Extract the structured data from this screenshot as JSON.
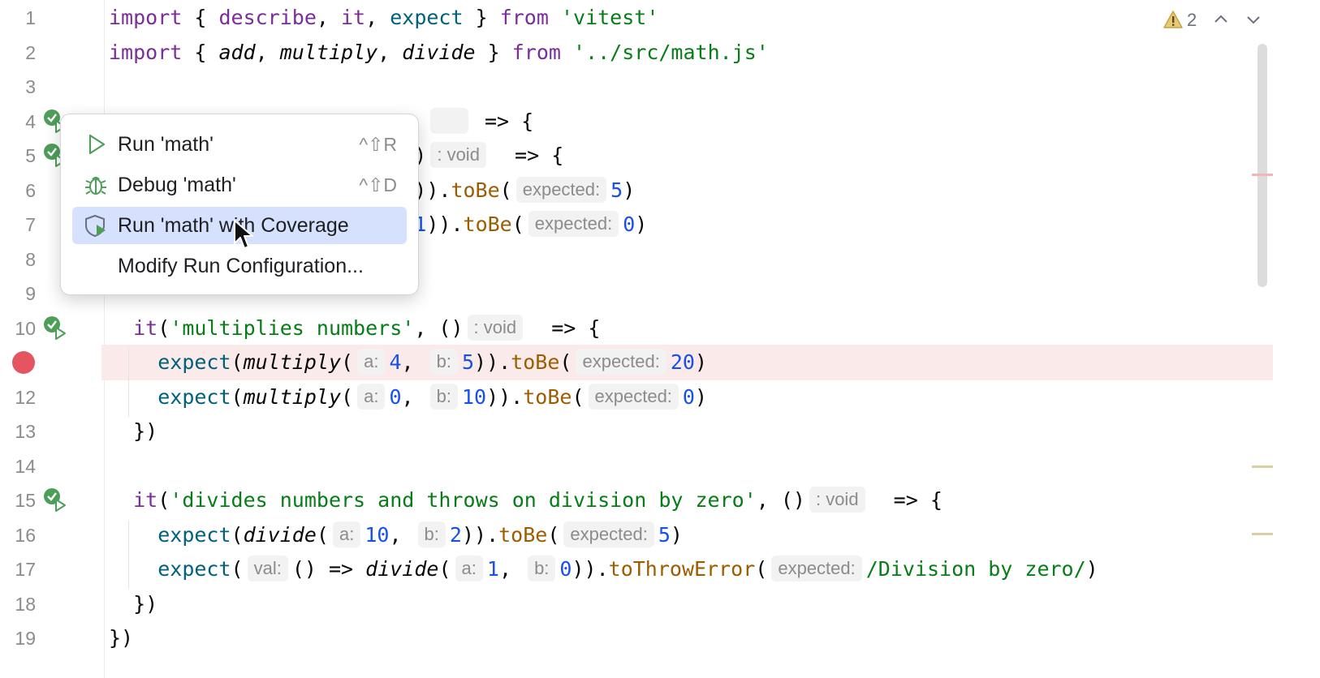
{
  "editor": {
    "lines": [
      {
        "n": "1",
        "segments": [
          {
            "t": "import",
            "c": "kw"
          },
          {
            "t": " { "
          },
          {
            "t": "describe",
            "c": "kw"
          },
          {
            "t": ", "
          },
          {
            "t": "it",
            "c": "kw"
          },
          {
            "t": ", "
          },
          {
            "t": "expect",
            "c": "fn"
          },
          {
            "t": " } "
          },
          {
            "t": "from",
            "c": "kw"
          },
          {
            "t": " "
          },
          {
            "t": "'vitest'",
            "c": "str"
          }
        ]
      },
      {
        "n": "2",
        "segments": [
          {
            "t": "import",
            "c": "kw"
          },
          {
            "t": " { "
          },
          {
            "t": "add",
            "c": "ital"
          },
          {
            "t": ", "
          },
          {
            "t": "multiply",
            "c": "ital"
          },
          {
            "t": ", "
          },
          {
            "t": "divide",
            "c": "ital"
          },
          {
            "t": " } "
          },
          {
            "t": "from",
            "c": "kw"
          },
          {
            "t": " "
          },
          {
            "t": "'../src/math.js'",
            "c": "str"
          }
        ]
      },
      {
        "n": "3",
        "segments": []
      },
      {
        "n": "4",
        "segments": [
          {
            "t": "                          "
          },
          {
            "t": "     ",
            "hint": true
          },
          {
            "t": " => {"
          }
        ]
      },
      {
        "n": "5",
        "segments": [
          {
            "t": "                         )"
          },
          {
            "t": ": void",
            "hint": true
          },
          {
            "t": "  => {"
          }
        ]
      },
      {
        "n": "6",
        "segments": [
          {
            "t": "                         ))."
          },
          {
            "t": "toBe",
            "c": "meth"
          },
          {
            "t": "("
          },
          {
            "t": "expected:",
            "hint": true
          },
          {
            "t": "5",
            "c": "num"
          },
          {
            "t": ")"
          }
        ]
      },
      {
        "n": "7",
        "segments": [
          {
            "t": "                         "
          },
          {
            "t": "1",
            "c": "num"
          },
          {
            "t": "))."
          },
          {
            "t": "toBe",
            "c": "meth"
          },
          {
            "t": "("
          },
          {
            "t": "expected:",
            "hint": true
          },
          {
            "t": "0",
            "c": "num"
          },
          {
            "t": ")"
          }
        ]
      },
      {
        "n": "8",
        "segments": []
      },
      {
        "n": "9",
        "segments": []
      },
      {
        "n": "10",
        "segments": [
          {
            "t": "  "
          },
          {
            "t": "it",
            "c": "kw"
          },
          {
            "t": "("
          },
          {
            "t": "'multiplies numbers'",
            "c": "str"
          },
          {
            "t": ", ()"
          },
          {
            "t": ": void",
            "hint": true
          },
          {
            "t": "  => {"
          }
        ]
      },
      {
        "n": "",
        "segments": [
          {
            "t": "    "
          },
          {
            "t": "expect",
            "c": "fn"
          },
          {
            "t": "("
          },
          {
            "t": "multiply",
            "c": "ital"
          },
          {
            "t": "("
          },
          {
            "t": "a:",
            "hint": true
          },
          {
            "t": "4",
            "c": "num"
          },
          {
            "t": ", "
          },
          {
            "t": "b:",
            "hint": true
          },
          {
            "t": "5",
            "c": "num"
          },
          {
            "t": "))."
          },
          {
            "t": "toBe",
            "c": "meth"
          },
          {
            "t": "("
          },
          {
            "t": "expected:",
            "hint": true
          },
          {
            "t": "20",
            "c": "num"
          },
          {
            "t": ")"
          }
        ]
      },
      {
        "n": "12",
        "segments": [
          {
            "t": "    "
          },
          {
            "t": "expect",
            "c": "fn"
          },
          {
            "t": "("
          },
          {
            "t": "multiply",
            "c": "ital"
          },
          {
            "t": "("
          },
          {
            "t": "a:",
            "hint": true
          },
          {
            "t": "0",
            "c": "num"
          },
          {
            "t": ", "
          },
          {
            "t": "b:",
            "hint": true
          },
          {
            "t": "10",
            "c": "num"
          },
          {
            "t": "))."
          },
          {
            "t": "toBe",
            "c": "meth"
          },
          {
            "t": "("
          },
          {
            "t": "expected:",
            "hint": true
          },
          {
            "t": "0",
            "c": "num"
          },
          {
            "t": ")"
          }
        ]
      },
      {
        "n": "13",
        "segments": [
          {
            "t": "  })"
          }
        ]
      },
      {
        "n": "14",
        "segments": []
      },
      {
        "n": "15",
        "segments": [
          {
            "t": "  "
          },
          {
            "t": "it",
            "c": "kw"
          },
          {
            "t": "("
          },
          {
            "t": "'divides numbers and throws on division by zero'",
            "c": "str"
          },
          {
            "t": ", ()"
          },
          {
            "t": ": void",
            "hint": true
          },
          {
            "t": "  => {"
          }
        ]
      },
      {
        "n": "16",
        "segments": [
          {
            "t": "    "
          },
          {
            "t": "expect",
            "c": "fn"
          },
          {
            "t": "("
          },
          {
            "t": "divide",
            "c": "ital"
          },
          {
            "t": "("
          },
          {
            "t": "a:",
            "hint": true
          },
          {
            "t": "10",
            "c": "num"
          },
          {
            "t": ", "
          },
          {
            "t": "b:",
            "hint": true
          },
          {
            "t": "2",
            "c": "num"
          },
          {
            "t": "))."
          },
          {
            "t": "toBe",
            "c": "meth"
          },
          {
            "t": "("
          },
          {
            "t": "expected:",
            "hint": true
          },
          {
            "t": "5",
            "c": "num"
          },
          {
            "t": ")"
          }
        ]
      },
      {
        "n": "17",
        "segments": [
          {
            "t": "    "
          },
          {
            "t": "expect",
            "c": "fn"
          },
          {
            "t": "("
          },
          {
            "t": "val:",
            "hint": true
          },
          {
            "t": "() => "
          },
          {
            "t": "divide",
            "c": "ital"
          },
          {
            "t": "("
          },
          {
            "t": "a:",
            "hint": true
          },
          {
            "t": "1",
            "c": "num"
          },
          {
            "t": ", "
          },
          {
            "t": "b:",
            "hint": true
          },
          {
            "t": "0",
            "c": "num"
          },
          {
            "t": "))."
          },
          {
            "t": "toThrowError",
            "c": "meth"
          },
          {
            "t": "("
          },
          {
            "t": "expected:",
            "hint": true
          },
          {
            "t": "/Division by zero/",
            "c": "str"
          },
          {
            "t": ")"
          }
        ]
      },
      {
        "n": "18",
        "segments": [
          {
            "t": "  })"
          }
        ]
      },
      {
        "n": "19",
        "segments": [
          {
            "t": "})"
          }
        ]
      }
    ],
    "breakpoint_line_index": 10,
    "test_icon_lines": [
      3,
      4,
      9,
      14
    ]
  },
  "inspections": {
    "warning_count": "2",
    "warning_icon": "warning-triangle-icon",
    "prev_icon": "chevron-up-icon",
    "next_icon": "chevron-down-icon"
  },
  "popup": {
    "items": [
      {
        "label": "Run 'math'",
        "shortcut": "^⇧R",
        "icon": "run-icon",
        "selected": false
      },
      {
        "label": "Debug 'math'",
        "shortcut": "^⇧D",
        "icon": "debug-bug-icon",
        "selected": false
      },
      {
        "label": "Run 'math' with Coverage",
        "shortcut": "",
        "icon": "coverage-shield-icon",
        "selected": true
      },
      {
        "label": "Modify Run Configuration...",
        "shortcut": "",
        "icon": "",
        "selected": false
      }
    ]
  },
  "colors": {
    "keyword": "#7a2d9b",
    "string": "#067d17",
    "number": "#1750eb",
    "method": "#9e5c00",
    "breakpoint": "#e55561",
    "selection": "#d5e1fd",
    "test_passed": "#4d9e59"
  }
}
